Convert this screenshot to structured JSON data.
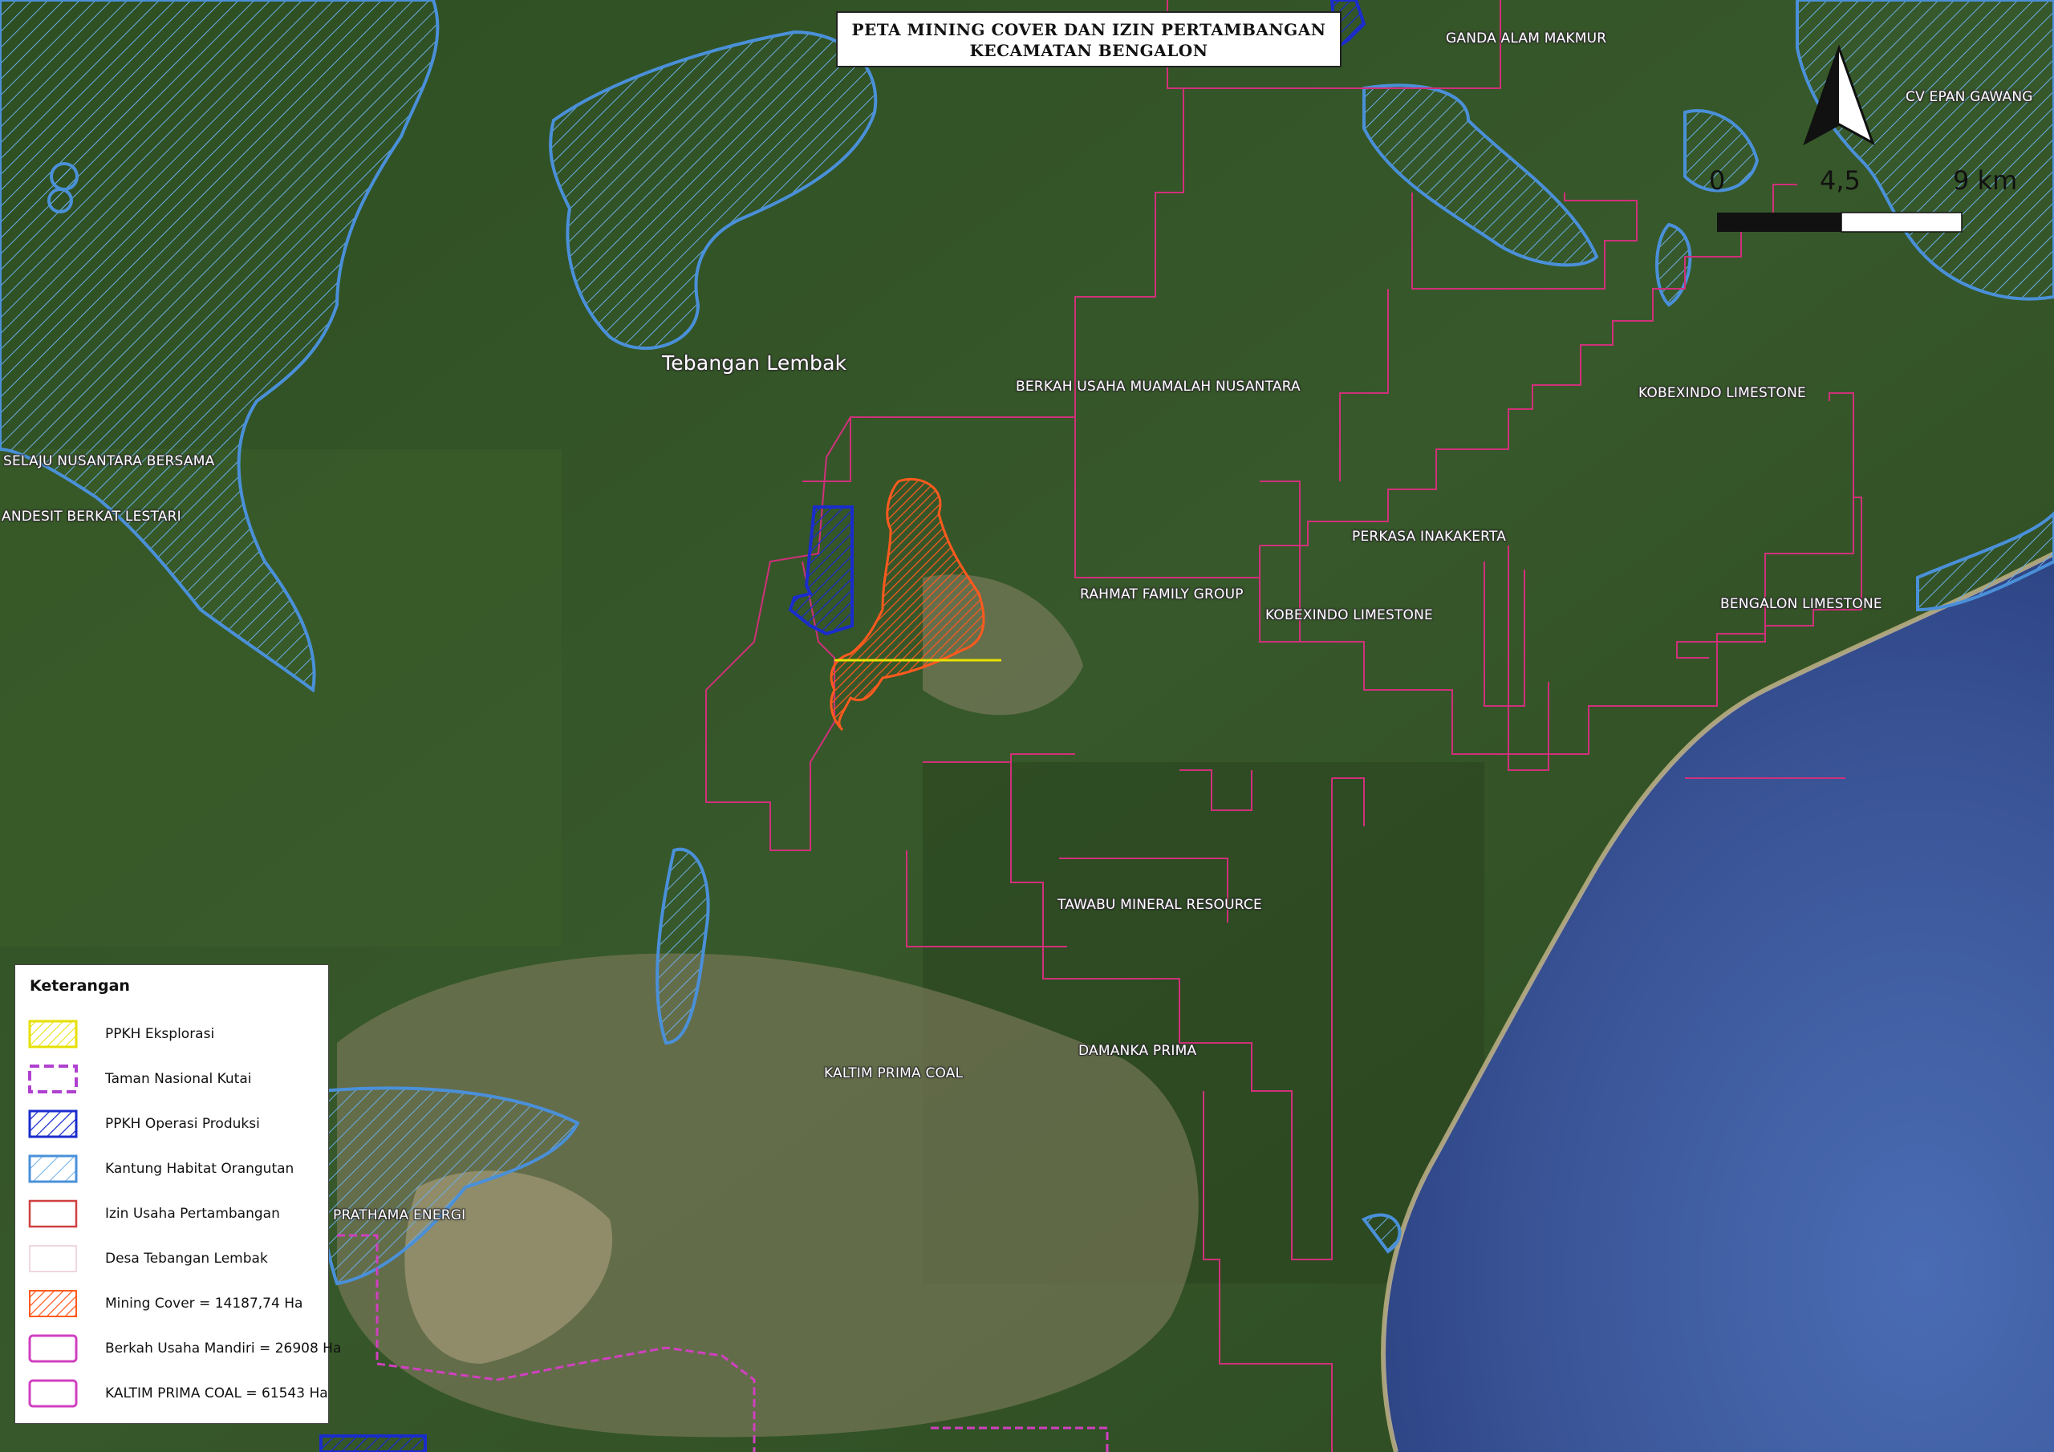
{
  "map": {
    "title_line1": "PETA MINING COVER DAN IZIN PERTAMBANGAN",
    "title_line2": "KECAMATAN BENGALON",
    "scale": {
      "labels": [
        "0",
        "4,5",
        "9 km"
      ]
    },
    "colors": {
      "forest": "#2f4f24",
      "sea": "#3c5a9c",
      "habitat_outline": "#4a90d9",
      "permit_outline": "#d0307a",
      "mining_cover": "#ff5a1e",
      "operasi_produksi": "#1a2ccc",
      "eksplorasi": "#e6e000",
      "taman_nasional": "#b040d0"
    },
    "place_labels": [
      {
        "id": "tebangan-lembak",
        "text": "Tebangan Lembak"
      },
      {
        "id": "ganda-alam-makmur",
        "text": "GANDA ALAM MAKMUR"
      },
      {
        "id": "cv-epan-gawang",
        "text": "CV EPAN GAWANG"
      },
      {
        "id": "berkah-usaha",
        "text": "BERKAH USAHA MUAMALAH NUSANTARA"
      },
      {
        "id": "kobexindo-1",
        "text": "KOBEXINDO LIMESTONE"
      },
      {
        "id": "selaju",
        "text": "SELAJU NUSANTARA BERSAMA"
      },
      {
        "id": "andesit",
        "text": "ANDESIT BERKAT LESTARI"
      },
      {
        "id": "perkasa",
        "text": "PERKASA INAKAKERTA"
      },
      {
        "id": "rahmat",
        "text": "RAHMAT FAMILY GROUP"
      },
      {
        "id": "kobexindo-2",
        "text": "KOBEXINDO LIMESTONE"
      },
      {
        "id": "bengalon-limestone",
        "text": "BENGALON LIMESTONE"
      },
      {
        "id": "tawabu",
        "text": "TAWABU MINERAL RESOURCE"
      },
      {
        "id": "damanka",
        "text": "DAMANKA PRIMA"
      },
      {
        "id": "kaltim-prima",
        "text": "KALTIM PRIMA COAL"
      },
      {
        "id": "prathama",
        "text": "PRATHAMA ENERGI"
      }
    ]
  },
  "legend": {
    "title": "Keterangan",
    "items": [
      {
        "label": "PPKH Eksplorasi",
        "icon": "yellow-hatch-icon",
        "color": "#e6e000"
      },
      {
        "label": "Taman Nasional Kutai",
        "icon": "purple-dashed-icon",
        "color": "#b040d0"
      },
      {
        "label": "PPKH Operasi Produksi",
        "icon": "blue-hatch-icon",
        "color": "#1a2ccc"
      },
      {
        "label": "Kantung Habitat Orangutan",
        "icon": "lightblue-hatch-icon",
        "color": "#4a90d9"
      },
      {
        "label": "Izin Usaha Pertambangan",
        "icon": "red-outline-icon",
        "color": "#d04040"
      },
      {
        "label": "Desa Tebangan Lembak",
        "icon": "pale-outline-icon",
        "color": "#f0d8e0"
      },
      {
        "label": "Mining Cover = 14187,74 Ha",
        "icon": "orange-hatch-icon",
        "color": "#ff5a1e"
      },
      {
        "label": "Berkah Usaha Mandiri = 26908 Ha",
        "icon": "magenta-outline-icon",
        "color": "#d040c0"
      },
      {
        "label": "KALTIM PRIMA COAL = 61543 Ha",
        "icon": "magenta-outline-icon-2",
        "color": "#d040c0"
      }
    ]
  }
}
